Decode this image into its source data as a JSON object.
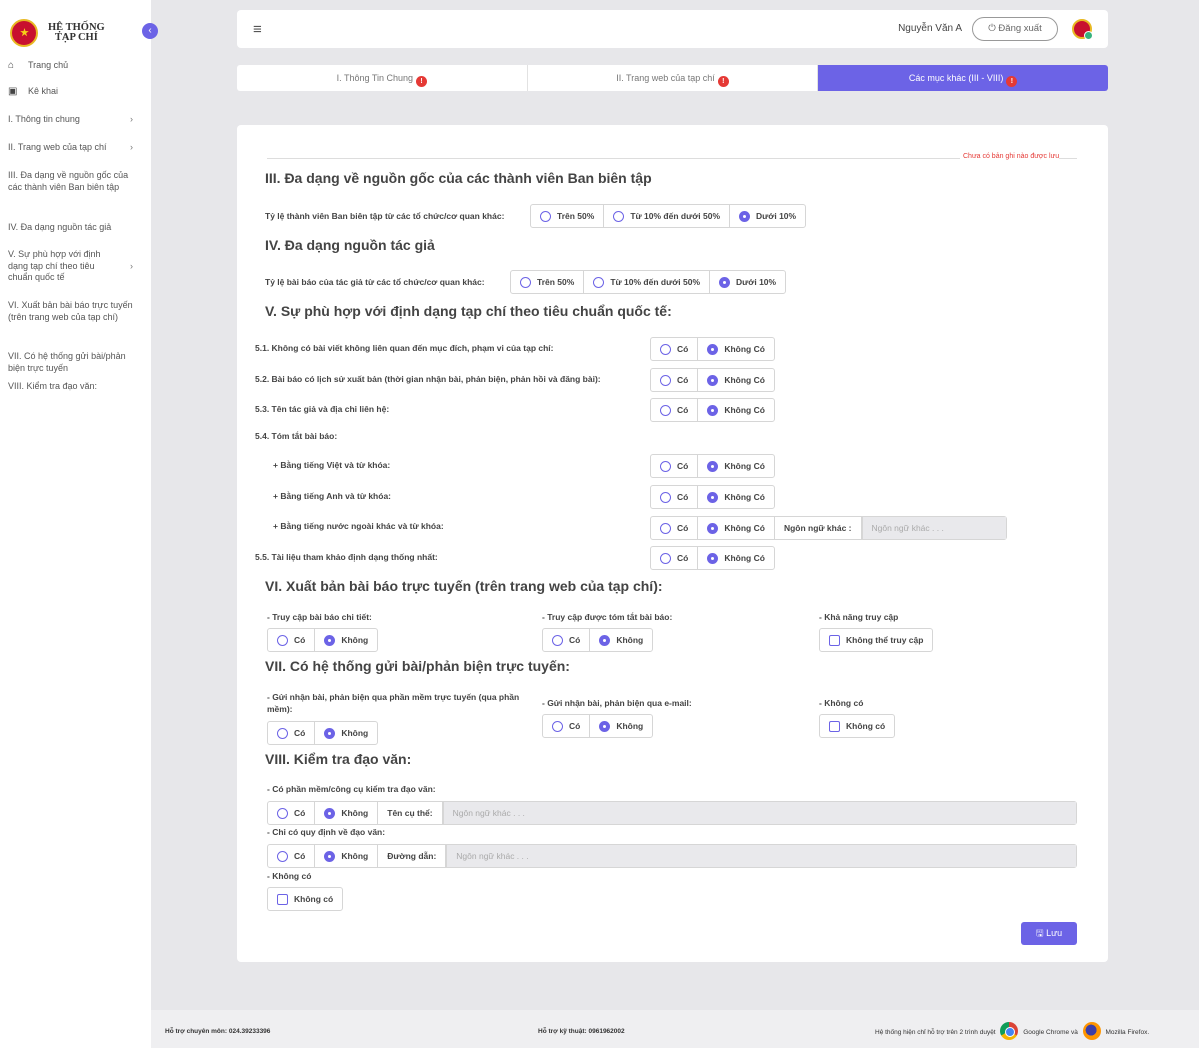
{
  "brand": {
    "line1": "HỆ THỐNG",
    "line2": "TẠP CHÍ"
  },
  "nav": [
    {
      "icon": "home-icon",
      "label": "Trang chủ"
    },
    {
      "icon": "calendar-icon",
      "label": "Kê khai"
    },
    {
      "label": "I. Thông tin chung",
      "chevron": true
    },
    {
      "label": "II. Trang web của tạp chí",
      "chevron": true
    },
    {
      "label": "III. Đa dạng về nguồn gốc của các thành viên Ban biên tập"
    },
    {
      "label": "IV. Đa dạng nguồn tác giả"
    },
    {
      "label": "V. Sự phù hợp với định dạng tạp chí theo tiêu chuẩn quốc tế",
      "chevron": true
    },
    {
      "label": "VI. Xuất bản bài báo trực tuyến (trên trang web của tạp chí)"
    },
    {
      "label": "VII. Có hệ thống gửi bài/phản biện trực tuyến"
    },
    {
      "label": "VIII. Kiểm tra đạo văn:"
    }
  ],
  "header": {
    "user": "Nguyễn Văn A",
    "logout": "Đăng xuất"
  },
  "tabs": [
    {
      "label": "I. Thông Tin Chung",
      "warn": "!"
    },
    {
      "label": "II. Trang web của tạp chí",
      "warn": "!"
    },
    {
      "label": "Các mục khác (III - VIII)",
      "warn": "!",
      "active": true
    }
  ],
  "status": "Chưa có bản ghi nào được lưu",
  "s3": {
    "title": "III. Đa dạng về nguồn gốc của các thành viên Ban biên tập",
    "q": "Tỷ lệ thành viên Ban biên tập từ các tổ chức/cơ quan khác:",
    "opts": [
      "Trên 50%",
      "Từ 10% đến dưới 50%",
      "Dưới 10%"
    ],
    "selected": 2
  },
  "s4": {
    "title": "IV. Đa dạng nguồn tác giả",
    "q": "Tỷ lệ bài báo của tác giả từ các tổ chức/cơ quan khác:",
    "opts": [
      "Trên 50%",
      "Từ 10% đến dưới 50%",
      "Dưới 10%"
    ],
    "selected": 2
  },
  "s5": {
    "title": "V. Sự phù hợp với định dạng tạp chí theo tiêu chuẩn quốc tế:",
    "q1": "5.1. Không có bài viết không liên quan đến mục đích, phạm vi của tạp chí:",
    "q2": "5.2. Bài báo có lịch sử xuất bản (thời gian nhận bài, phản biện, phản hồi và đăng bài):",
    "q3": "5.3. Tên tác giả và địa chỉ liên hệ:",
    "q4": "5.4. Tóm tắt bài báo:",
    "q4a": "+ Bằng tiếng Việt và từ khóa:",
    "q4b": "+ Bằng tiếng Anh và từ khóa:",
    "q4c": "+ Bằng tiếng nước ngoài khác và từ khóa:",
    "q5": "5.5. Tài liệu tham khảo định dạng thống nhất:",
    "yes": "Có",
    "no": "Không Có",
    "other_lang": "Ngôn ngữ khác :",
    "other_ph": "Ngôn ngữ khác . . ."
  },
  "s6": {
    "title": "VI. Xuất bản bài báo trực tuyến (trên trang web của tạp chí):",
    "a": "- Truy cập bài báo chi tiết:",
    "b": "- Truy cập được tóm tắt bài báo:",
    "c": "- Khả năng truy cập",
    "yes": "Có",
    "no": "Không",
    "cant": "Không thể truy cập"
  },
  "s7": {
    "title": "VII. Có hệ thống gửi bài/phản biện trực tuyến:",
    "a": "- Gửi nhận bài, phản biện qua phần mềm trực tuyến (qua phần mềm):",
    "b": "- Gửi nhận bài, phản biện qua e-mail:",
    "c": "- Không có",
    "yes": "Có",
    "no": "Không",
    "none": "Không có"
  },
  "s8": {
    "title": "VIII. Kiểm tra đạo văn:",
    "a": "- Có phần mềm/công cụ kiểm tra đạo văn:",
    "a_field": "Tên cụ thể:",
    "b": "- Chỉ có quy định về đạo văn:",
    "b_field": "Đường dẫn:",
    "c": "- Không có",
    "ph": "Ngôn ngữ khác . . .",
    "yes": "Có",
    "no": "Không",
    "none": "Không có"
  },
  "save": "Lưu",
  "footer": {
    "pro": "Hỗ trợ chuyên môn: 024.39233396",
    "tech": "Hỗ trợ kỹ thuật: 0961962002",
    "support": "Hệ thống hiện chỉ hỗ trợ trên 2 trình duyệt",
    "chrome": "Google Chrome và",
    "firefox": "Mozilla Firefox."
  }
}
